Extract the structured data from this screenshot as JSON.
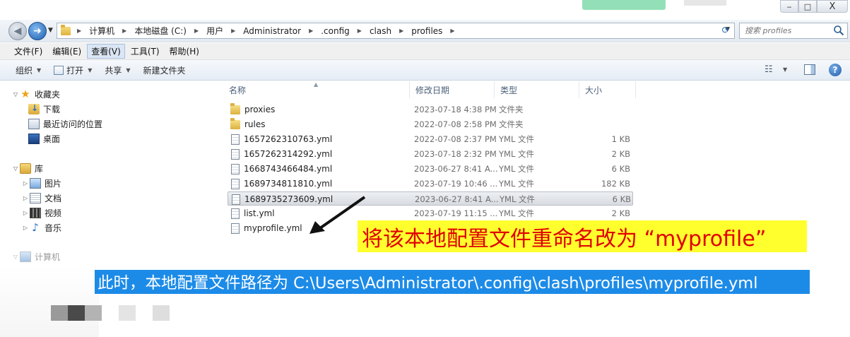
{
  "window": {
    "min_label": "‒",
    "max_label": "□",
    "close_label": "X"
  },
  "address": {
    "crumbs": [
      "计算机",
      "本地磁盘 (C:)",
      "用户",
      "Administrator",
      ".config",
      "clash",
      "profiles"
    ],
    "search_placeholder": "搜索 profiles"
  },
  "menu": {
    "items": [
      "文件(F)",
      "编辑(E)",
      "查看(V)",
      "工具(T)",
      "帮助(H)"
    ]
  },
  "commands": {
    "organize": "组织",
    "open": "打开",
    "share": "共享",
    "new_folder": "新建文件夹"
  },
  "nav": {
    "favorites": "收藏夹",
    "downloads": "下载",
    "recent": "最近访问的位置",
    "desktop": "桌面",
    "libraries": "库",
    "pictures": "图片",
    "documents": "文档",
    "videos": "视频",
    "music": "音乐",
    "computer": "计算机"
  },
  "columns": {
    "name": "名称",
    "modified": "修改日期",
    "type": "类型",
    "size": "大小"
  },
  "files": [
    {
      "name": "proxies",
      "modified": "2023-07-18 4:38 PM",
      "type": "文件夹",
      "size": "",
      "kind": "folder"
    },
    {
      "name": "rules",
      "modified": "2022-07-08 2:58 PM",
      "type": "文件夹",
      "size": "",
      "kind": "folder"
    },
    {
      "name": "1657262310763.yml",
      "modified": "2022-07-08 2:37 PM",
      "type": "YML 文件",
      "size": "1 KB",
      "kind": "file"
    },
    {
      "name": "1657262314292.yml",
      "modified": "2023-07-18 2:32 PM",
      "type": "YML 文件",
      "size": "2 KB",
      "kind": "file"
    },
    {
      "name": "1668743466484.yml",
      "modified": "2023-06-27 8:41 A...",
      "type": "YML 文件",
      "size": "6 KB",
      "kind": "file"
    },
    {
      "name": "1689734811810.yml",
      "modified": "2023-07-19 10:46 ...",
      "type": "YML 文件",
      "size": "182 KB",
      "kind": "file"
    },
    {
      "name": "1689735273609.yml",
      "modified": "2023-06-27 8:41 A...",
      "type": "YML 文件",
      "size": "6 KB",
      "kind": "file"
    },
    {
      "name": "list.yml",
      "modified": "2023-07-19 11:15 ...",
      "type": "YML 文件",
      "size": "2 KB",
      "kind": "file"
    },
    {
      "name": "myprofile.yml",
      "modified": "",
      "type": "",
      "size": "",
      "kind": "file"
    }
  ],
  "annotations": {
    "rename_note": "将该本地配置文件重命名改为 “myprofile”",
    "path_note": "此时，本地配置文件路径为 C:\\Users\\Administrator\\.config\\clash\\profiles\\myprofile.yml"
  },
  "colors": {
    "callout_yellow_bg": "#ffff2e",
    "callout_yellow_text": "#e00000",
    "callout_blue_bg": "#1c8be8",
    "callout_blue_text": "#ffffff"
  }
}
